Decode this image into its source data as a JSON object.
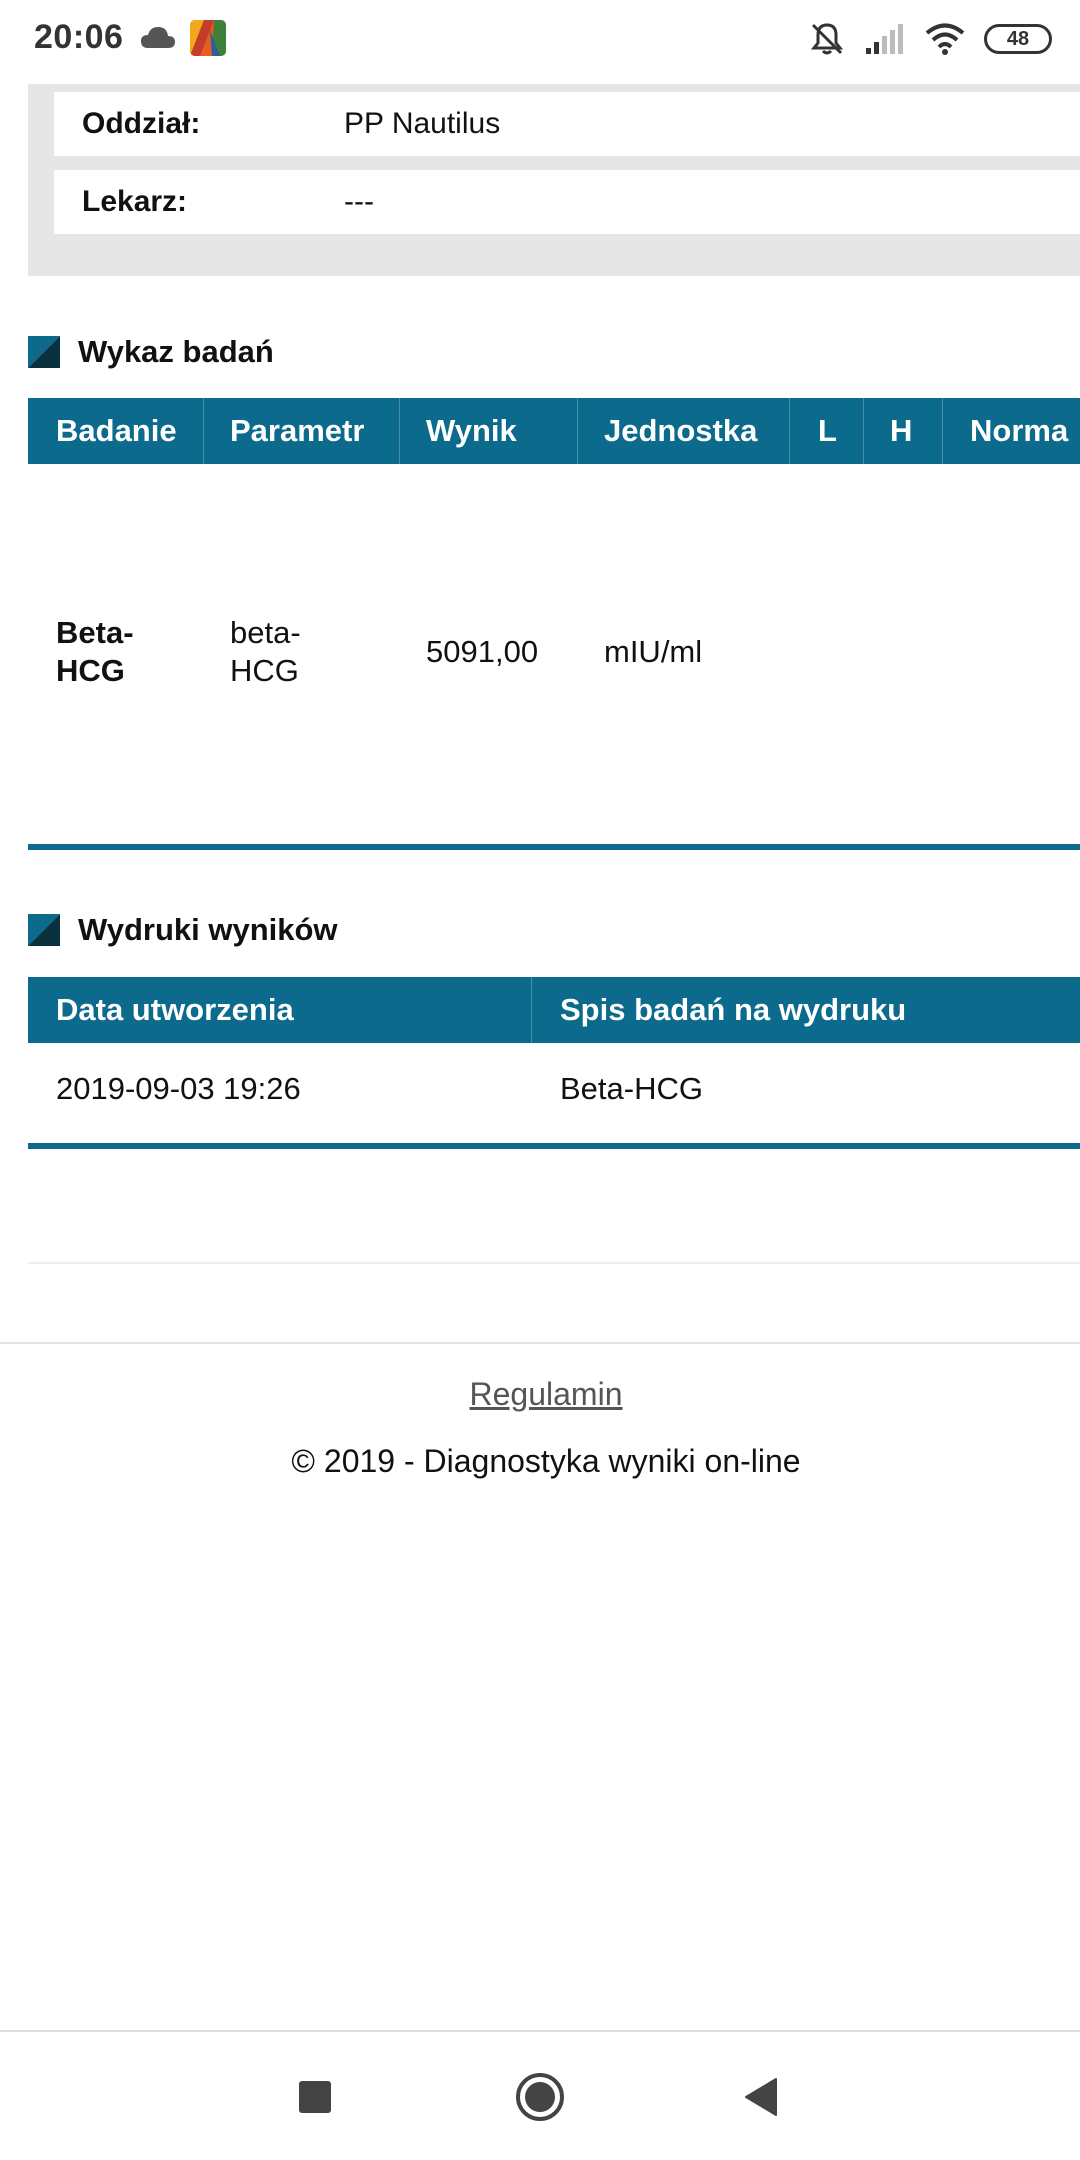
{
  "status_bar": {
    "time": "20:06",
    "battery": "48",
    "icons": [
      "cloud-icon",
      "app-icon",
      "bell-off-icon",
      "signal-icon",
      "wifi-icon",
      "battery-icon"
    ]
  },
  "info": {
    "rows": [
      {
        "label": "Oddział:",
        "value": "PP Nautilus"
      },
      {
        "label": "Lekarz:",
        "value": "---"
      }
    ]
  },
  "tests_section": {
    "title": "Wykaz badań",
    "columns": [
      "Badanie",
      "Parametr",
      "Wynik",
      "Jednostka",
      "L",
      "H",
      "Norma"
    ],
    "rows": [
      {
        "badanie": "Beta-\nHCG",
        "parametr": "beta-\nHCG",
        "wynik": "5091,00",
        "jednostka": "mIU/ml",
        "l": "",
        "h": "",
        "norma": ""
      }
    ]
  },
  "prints_section": {
    "title": "Wydruki wyników",
    "columns": [
      "Data utworzenia",
      "Spis badań na wydruku"
    ],
    "rows": [
      {
        "data": "2019-09-03 19:26",
        "spis": "Beta-HCG"
      }
    ]
  },
  "footer": {
    "link": "Regulamin",
    "copyright": "© 2019 - Diagnostyka wyniki on-line"
  },
  "colors": {
    "accent": "#0c6a8d",
    "panel_bg": "#e6e6e6"
  }
}
